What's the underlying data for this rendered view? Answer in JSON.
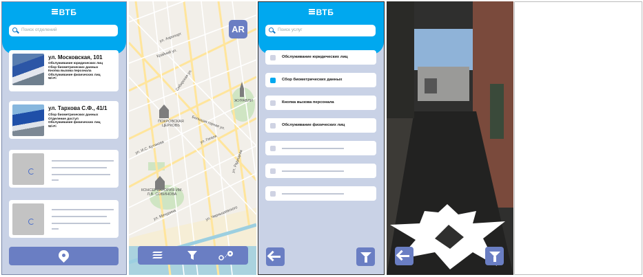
{
  "app": {
    "logo_text": "ВТБ"
  },
  "branch_list": {
    "search_placeholder": "Поиск отделений",
    "cards": [
      {
        "title": "ул. Московская, 101",
        "services": [
          "Обслуживание юридических лиц",
          "Сбор биометрических данных",
          "Кнопка вызова персонала",
          "Обслуживание физических лиц",
          "Wi-Fi"
        ]
      },
      {
        "title": "ул. Тархова С.Ф., 41/1",
        "services": [
          "Сбор биометрических данных",
          "Отделение доступ",
          "Обслуживание физических лиц",
          "Wi-Fi"
        ]
      }
    ],
    "bottom_icon": "location-pin-icon"
  },
  "map_view": {
    "ar_label": "AR",
    "labels": [
      "ул. Аэропорт",
      "Крайний ул.",
      "Сибирская ул.",
      "ПОКРОВСКАЯ ЦЕРКОВЬ",
      "Большая горная ул.",
      "ул. И.С. Кутякова",
      "ул. Мичурина",
      "КОНСЕРВАТОРИЯ ИМ. Л.В. СОБИНОВА",
      "ЖУРАВЛИ",
      "ул. Чернышевского",
      "ул. Гоголя",
      "ул. Радищева"
    ],
    "toolbar": [
      "list-icon",
      "filter-icon",
      "route-icon"
    ]
  },
  "filter_view": {
    "search_placeholder": "Поиск услуг",
    "options": [
      {
        "label": "Обслуживание юридических лиц",
        "checked": false
      },
      {
        "label": "Сбор биометрических данных",
        "checked": true
      },
      {
        "label": "Кнопка вызова персонала",
        "checked": false
      },
      {
        "label": "Обслуживание физических лиц",
        "checked": false
      }
    ],
    "back_icon": "back-arrow-icon",
    "filter_icon": "filter-icon"
  },
  "ar_view": {
    "back_icon": "back-arrow-icon",
    "filter_icon": "filter-icon",
    "marker_icon": "star-marker-icon"
  }
}
